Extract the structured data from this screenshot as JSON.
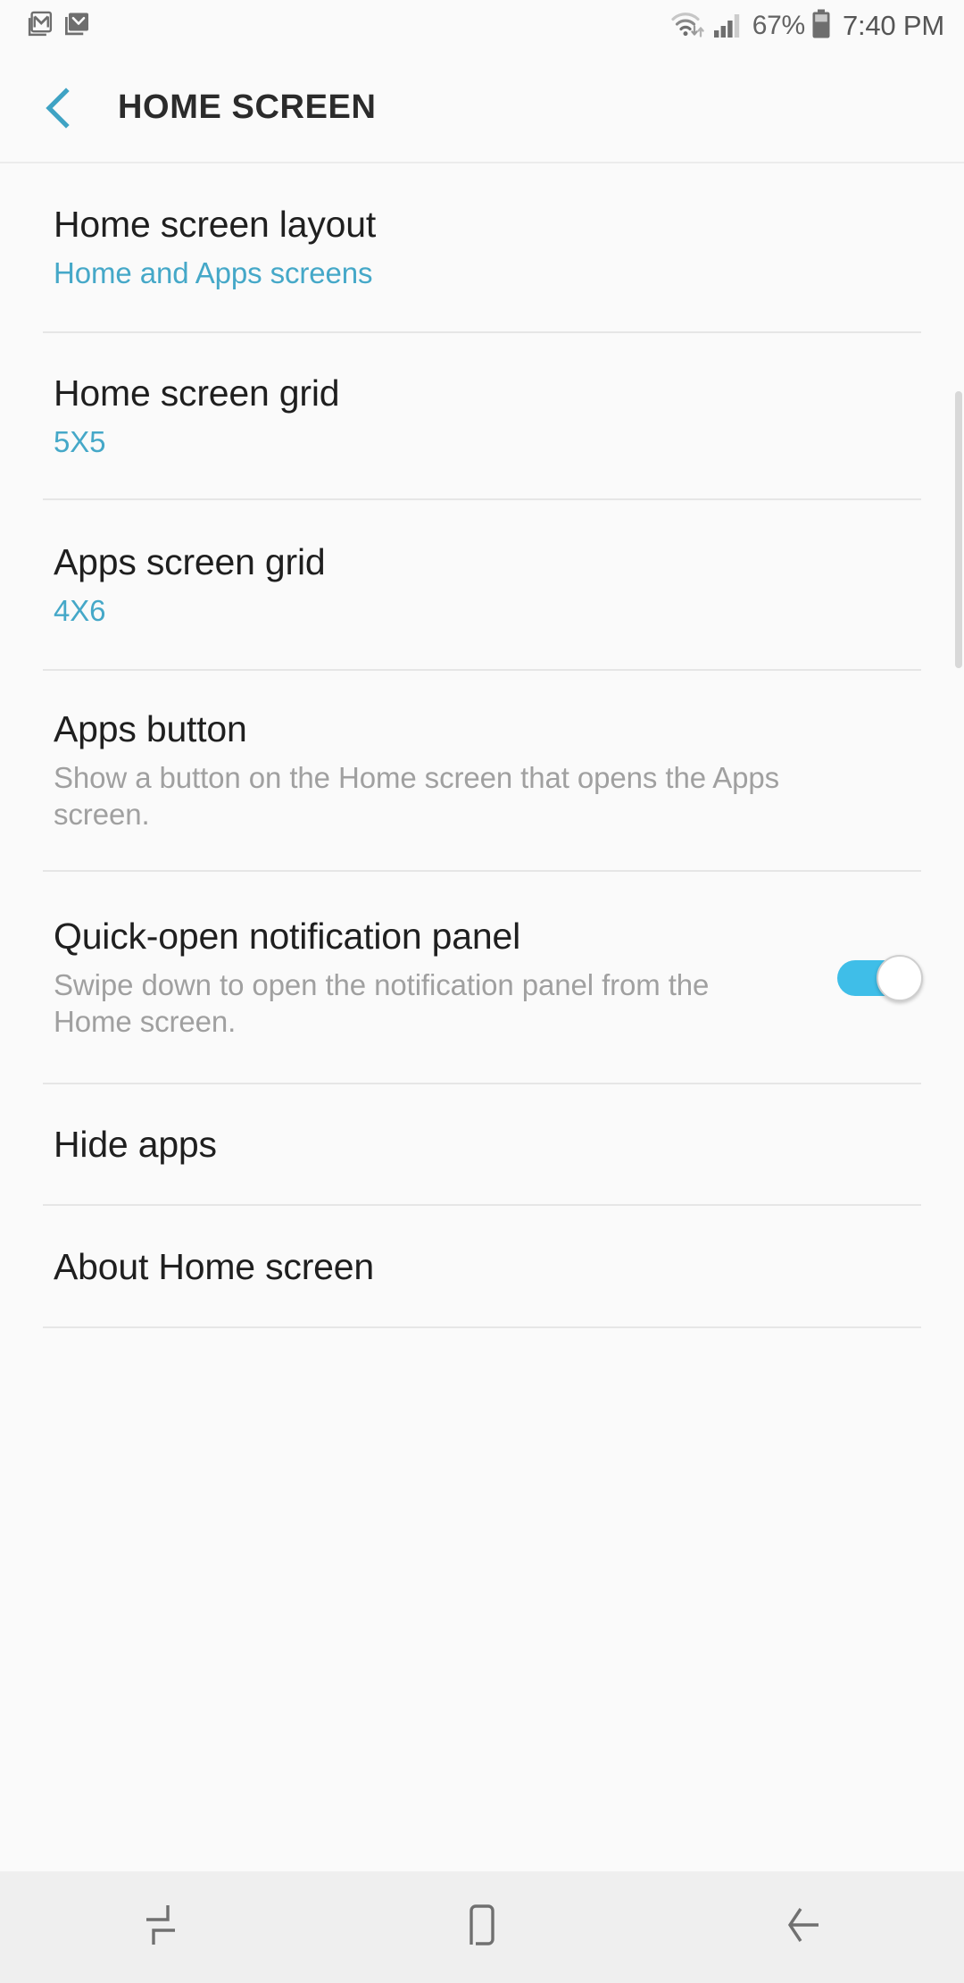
{
  "status_bar": {
    "notification_icons": [
      "gmail-icon",
      "email-envelope-icon"
    ],
    "wifi_icon": "wifi-with-transfer-arrows-icon",
    "signal_icon": "cellular-signal-icon",
    "battery_percent": "67%",
    "battery_icon": "battery-icon",
    "time": "7:40 PM"
  },
  "app_bar": {
    "back_icon": "back-chevron-icon",
    "title": "HOME SCREEN"
  },
  "colors": {
    "accent": "#45a8c8",
    "toggle_on": "#3fbee8",
    "back_chevron": "#3fa3c4",
    "background": "#fafafa",
    "divider": "#e6e6e6",
    "title_text": "#1f1f1f",
    "muted_text": "#a0a0a0",
    "nav_bar_bg": "#efefef"
  },
  "settings": [
    {
      "title": "Home screen layout",
      "subtitle": "Home and Apps screens",
      "subtitle_style": "accent",
      "has_toggle": false
    },
    {
      "title": "Home screen grid",
      "subtitle": "5X5",
      "subtitle_style": "accent",
      "has_toggle": false
    },
    {
      "title": "Apps screen grid",
      "subtitle": "4X6",
      "subtitle_style": "accent",
      "has_toggle": false
    },
    {
      "title": "Apps button",
      "subtitle": "Show a button on the Home screen that opens the Apps screen.",
      "subtitle_style": "muted",
      "has_toggle": false
    },
    {
      "title": "Quick-open notification panel",
      "subtitle": "Swipe down to open the notification panel from the Home screen.",
      "subtitle_style": "muted",
      "has_toggle": true,
      "toggle_state": "on"
    },
    {
      "title": "Hide apps",
      "subtitle": "",
      "subtitle_style": "none",
      "has_toggle": false
    },
    {
      "title": "About Home screen",
      "subtitle": "",
      "subtitle_style": "none",
      "has_toggle": false
    }
  ],
  "nav_bar": {
    "recents_icon": "recents-icon",
    "home_icon": "home-icon",
    "back_icon": "back-arrow-icon"
  }
}
